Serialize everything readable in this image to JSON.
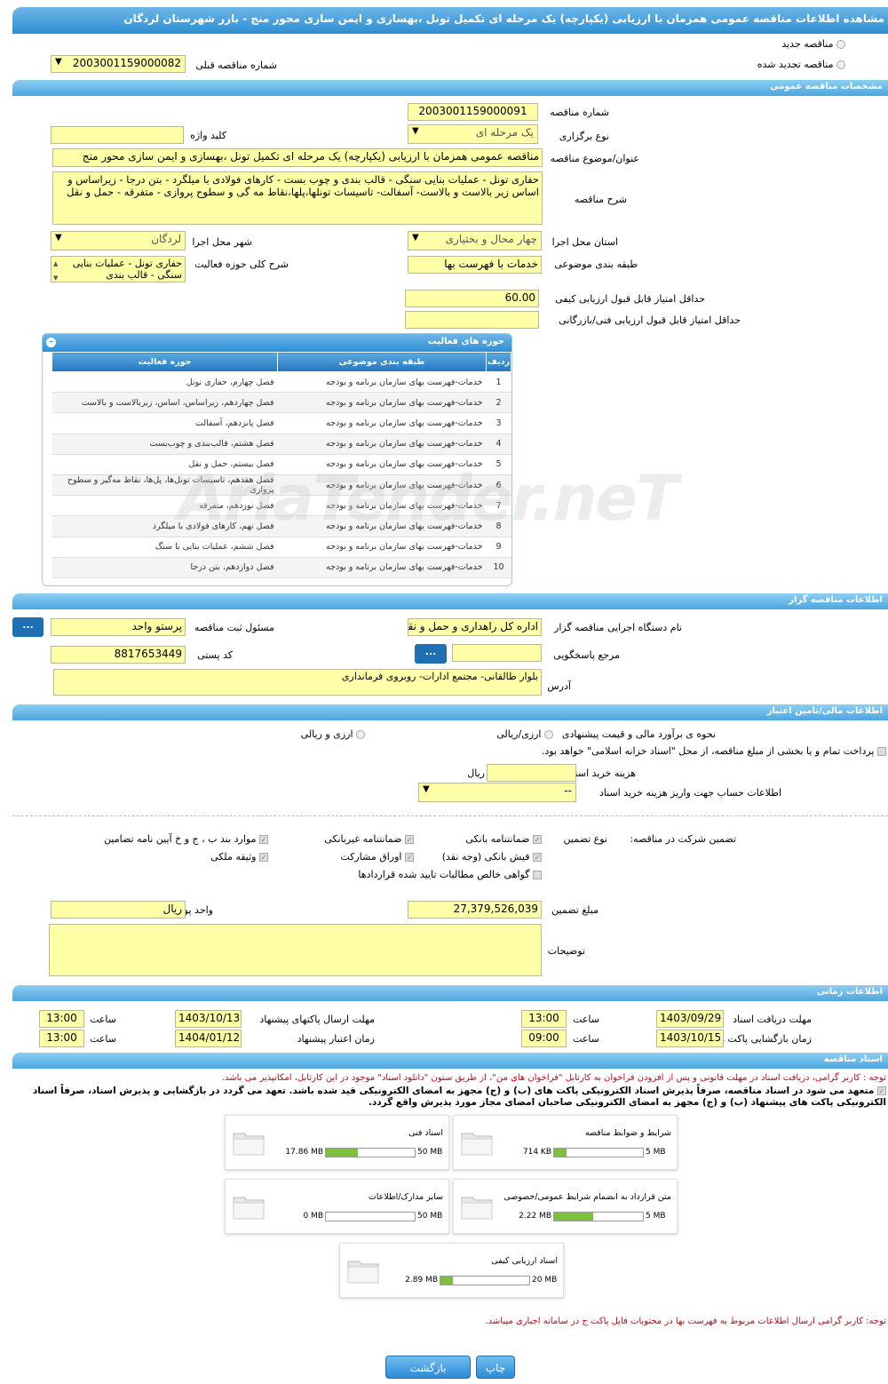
{
  "title": "مشاهده اطلاعات مناقصه عمومی همزمان با ارزیابی (یکپارچه) یک مرحله ای تکمیل تونل ،بهسازی و ایمن سازی محور منج - بازر شهرستان لردگان",
  "top": {
    "new_label": "مناقصه جدید",
    "renew_label": "مناقصه تجدید شده",
    "prev_label": "شماره مناقصه قبلی",
    "prev_value": "2003001159000082"
  },
  "general": {
    "header": "مشخصات مناقصه عمومی",
    "number_label": "شماره مناقصه",
    "number": "2003001159000091",
    "type_label": "نوع برگزاری",
    "type": "یک مرحله ای",
    "keyword_label": "کلید واژه",
    "keyword": "",
    "subject_label": "عنوان/موضوع مناقصه",
    "subject": "مناقصه عمومی همزمان با ارزیابی (یکپارچه) یک مرحله ای تکمیل تونل ،بهسازی و ایمن سازی محور منج",
    "desc_label": "شرح مناقصه",
    "desc": "حفاری تونل - عملیات بنایی سنگی - قالب بندی و چوب بست - کارهای فولادی با میلگرد - بتن درجا - زیراساس و اساس زیر بالاست و بالاست- آسفالت- تاسیسات تونلها،پلها،نقاط مه گی و سطوح پروازی - متفرقه - حمل و نقل",
    "province_label": "استان محل اجرا",
    "province": "چهار محال و بختیاری",
    "city_label": "شهر محل اجرا",
    "city": "لردگان",
    "category_label": "طبقه بندی موضوعی",
    "category": "خدمات با فهرست بها",
    "scope_label": "شرح کلی حوزه فعالیت",
    "scope": "حفاری تونل - عملیات بنایی سنگی - قالب بندی",
    "minq_label": "حداقل امتیاز قابل قبول ارزیابی کیفی",
    "minq": "60.00",
    "mint_label": "حداقل امتیاز قابل قبول ارزیابی فنی/بازرگانی",
    "mint": ""
  },
  "activities": {
    "header": "حوزه های فعالیت",
    "col_row": "ردیف",
    "col_cat": "طبقه بندی موضوعی",
    "col_scope": "حوزه فعالیت",
    "rows": [
      {
        "n": "1",
        "cat": "خدمات-فهرست بهای سازمان برنامه و بودجه",
        "scope": "فصل چهارم، حفاری تونل"
      },
      {
        "n": "2",
        "cat": "خدمات-فهرست بهای سازمان برنامه و بودجه",
        "scope": "فصل چهاردهم، زیراساس، اساس، زیربالاست و بالاست"
      },
      {
        "n": "3",
        "cat": "خدمات-فهرست بهای سازمان برنامه و بودجه",
        "scope": "فصل پانزدهم، آسفالت"
      },
      {
        "n": "4",
        "cat": "خدمات-فهرست بهای سازمان برنامه و بودجه",
        "scope": "فصل هشتم، قالب‌بندی و چوب‌بست"
      },
      {
        "n": "5",
        "cat": "خدمات-فهرست بهای سازمان برنامه و بودجه",
        "scope": "فصل بیستم، حمل و نقل"
      },
      {
        "n": "6",
        "cat": "خدمات-فهرست بهای سازمان برنامه و بودجه",
        "scope": "فصل هفدهم، تاسیسات تونل‌ها، پل‌ها، نقاط مه‌گیر و سطوح پروازی"
      },
      {
        "n": "7",
        "cat": "خدمات-فهرست بهای سازمان برنامه و بودجه",
        "scope": "فصل نوزدهم، متفرقه"
      },
      {
        "n": "8",
        "cat": "خدمات-فهرست بهای سازمان برنامه و بودجه",
        "scope": "فصل نهم، کارهای فولادی با میلگرد"
      },
      {
        "n": "9",
        "cat": "خدمات-فهرست بهای سازمان برنامه و بودجه",
        "scope": "فصل ششم، عملیات بنایی با سنگ"
      },
      {
        "n": "10",
        "cat": "خدمات-فهرست بهای سازمان برنامه و بودجه",
        "scope": "فصل دوازدهم، بتن درجا"
      }
    ]
  },
  "watermark": "AriaTender.neT",
  "organizer": {
    "header": "اطلاعات مناقصه گزار",
    "org_label": "نام دستگاه اجرایی مناقصه گزار",
    "org": "اداره کل راهداری و حمل و نقل",
    "resp_label": "مسئول ثبت مناقصه",
    "resp": "پرستو واحد",
    "ref_label": "مرجع پاسخگویی",
    "ref": "",
    "postal_label": "کد پستی",
    "postal": "8817653449",
    "addr_label": "آدرس",
    "addr": "بلوار طالقانی- مجتمع ادارات- روبروی فرمانداری",
    "dots": "..."
  },
  "finance": {
    "header": "اطلاعات مالی/تامین اعتبار",
    "est_label": "نحوه ی برآورد مالی و قیمت پیشنهادی",
    "opt1": "ارزی/ریالی",
    "opt2": "ارزی و ریالی",
    "treasury": "پرداخت تمام و یا بخشی از مبلغ مناقصه، از محل \"اسناد خزانه اسلامی\" خواهد بود.",
    "fee_label": "هزینه خرید اسناد",
    "fee": "",
    "fee_unit": "ریال",
    "acct_label": "اطلاعات حساب جهت واریز هزینه خرید اسناد",
    "acct": "--"
  },
  "guarantee": {
    "label": "تضمین شرکت در مناقصه:",
    "type_label": "نوع تضمین",
    "items": [
      "ضمانتنامه بانکی",
      "ضمانتنامه غیربانکی",
      "موارد بند ب ، ج و خ آیین نامه تضامین",
      "فیش بانکی (وجه نقد)",
      "اوراق مشارکت",
      "وثیقه ملکی",
      "گواهی خالص مطالبات تایید شده قراردادها"
    ],
    "amount_label": "مبلغ تضمین",
    "amount": "27,379,526,039",
    "unit_label": "واحد پول",
    "unit": "ریال",
    "notes_label": "توضیحات",
    "notes": ""
  },
  "timing": {
    "header": "اطلاعات زمانی",
    "recv_label": "مهلت دریافت اسناد",
    "recv_date": "1403/09/29",
    "recv_time": "13:00",
    "send_label": "مهلت ارسال پاکتهای پیشنهاد",
    "send_date": "1403/10/13",
    "send_time": "13:00",
    "open_label": "زمان بازگشایی پاکت ها",
    "open_date": "1403/10/15",
    "open_time": "09:00",
    "valid_label": "زمان اعتبار پیشنهاد",
    "valid_date": "1404/01/12",
    "valid_time": "13:00",
    "time_label": "ساعت"
  },
  "docs": {
    "header": "اسناد مناقصه",
    "note1": "توجه : کاربر گرامی، دریافت اسناد در مهلت قانونی و پس از افزودن فراخوان به کارتابل \"فراخوان های من\"، از طریق ستون \"دانلود اسناد\" موجود در این کارتابل، امکانپذیر می باشد.",
    "commit": "متعهد می شود در اسناد مناقصه، صرفاً پذیرش اسناد الکترونیکی پاکت های (ب) و (ج) مجهز به امضای الکترونیکی قید شده باشد. تعهد می گردد در بازگشایی و پذیرش اسناد، صرفاً اسناد الکترونیکی پاکت های پیشنهاد (ب) و (ج) مجهز به امضای الکترونیکی صاحبان امضای مجاز مورد پذیرش واقع گردد.",
    "files": [
      {
        "name": "شرایط و ضوابط مناقصه",
        "size": "714 KB",
        "max": "5 MB",
        "pct": 14
      },
      {
        "name": "اسناد فنی",
        "size": "17.86 MB",
        "max": "50 MB",
        "pct": 36
      },
      {
        "name": "متن قرارداد به انضمام شرایط عمومی/خصوصی",
        "size": "2.22 MB",
        "max": "5 MB",
        "pct": 44
      },
      {
        "name": "سایر مدارک/اطلاعات",
        "size": "0 MB",
        "max": "50 MB",
        "pct": 0
      },
      {
        "name": "اسناد ارزیابی کیفی",
        "size": "2.89 MB",
        "max": "20 MB",
        "pct": 14
      }
    ],
    "note2": "توجه: کاربر گرامی ارسال اطلاعات مربوط به فهرست بها در محتویات فایل پاکت ج در سامانه اجباری میباشد."
  },
  "buttons": {
    "print": "چاپ",
    "back": "بازگشت"
  }
}
